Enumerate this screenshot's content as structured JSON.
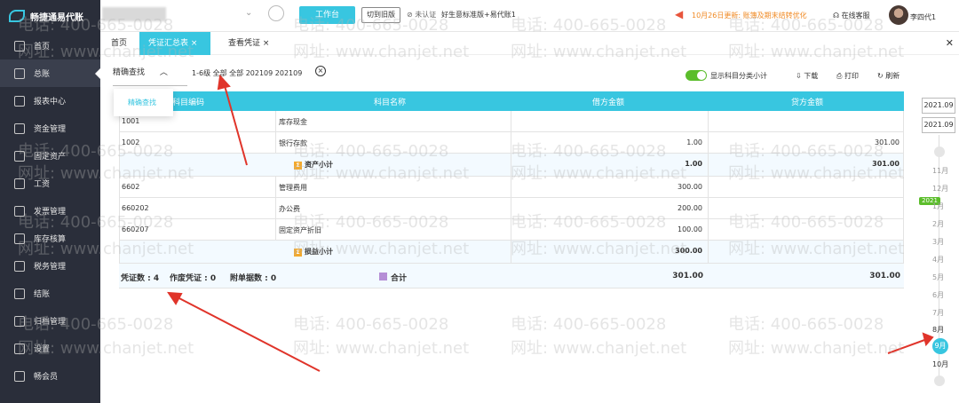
{
  "app": {
    "logo_text": "畅捷通易代账"
  },
  "header": {
    "workbench_label": "工作台",
    "switch_label": "切到旧版",
    "unverified_label": "未认证",
    "edition_label": "好生意标准版+易代账1",
    "notice_text": "10月26日更新: 账簿及期末结转优化",
    "service_label": "在线客服",
    "username": "李四代1"
  },
  "sidebar": {
    "items": [
      {
        "label": "首页",
        "icon": "home-icon"
      },
      {
        "label": "总账",
        "icon": "ledger-icon"
      },
      {
        "label": "报表中心",
        "icon": "chart-icon"
      },
      {
        "label": "资金管理",
        "icon": "money-icon"
      },
      {
        "label": "固定资产",
        "icon": "asset-icon"
      },
      {
        "label": "工资",
        "icon": "salary-icon"
      },
      {
        "label": "发票管理",
        "icon": "invoice-icon"
      },
      {
        "label": "库存核算",
        "icon": "stock-icon"
      },
      {
        "label": "税务管理",
        "icon": "tax-icon"
      },
      {
        "label": "结账",
        "icon": "close-book-icon"
      },
      {
        "label": "归档管理",
        "icon": "archive-icon"
      },
      {
        "label": "设置",
        "icon": "gear-icon"
      },
      {
        "label": "畅会员",
        "icon": "vip-icon"
      }
    ]
  },
  "tabs": [
    {
      "label": "首页"
    },
    {
      "label": "凭证汇总表"
    },
    {
      "label": "查看凭证"
    }
  ],
  "toolbar": {
    "search_label": "精确查找",
    "filter_text": "1-6级  全部 全部 202109 202109",
    "toggle_label": "显示科目分类小计",
    "download_label": "下载",
    "print_label": "打印",
    "refresh_label": "刷新"
  },
  "dropdown": {
    "item": "精确查找"
  },
  "table": {
    "headers": [
      "科目编码",
      "科目名称",
      "借方金额",
      "贷方金额"
    ],
    "rows": [
      {
        "code": "1001",
        "name": "库存现金",
        "debit": "",
        "credit": ""
      },
      {
        "code": "1002",
        "name": "银行存款",
        "debit": "1.00",
        "credit": "301.00"
      }
    ],
    "subtotal1": {
      "label": "资产小计",
      "debit": "1.00",
      "credit": "301.00"
    },
    "rows2": [
      {
        "code": "6602",
        "name": "管理费用",
        "debit": "300.00",
        "credit": ""
      },
      {
        "code": "660202",
        "name": "办公费",
        "debit": "200.00",
        "credit": ""
      },
      {
        "code": "660207",
        "name": "固定资产折旧",
        "debit": "100.00",
        "credit": ""
      }
    ],
    "subtotal2": {
      "label": "损益小计",
      "debit": "300.00",
      "credit": ""
    },
    "footer": {
      "voucher_count": "凭证数 : 4",
      "void_count": "作废凭证 : 0",
      "attach_count": "附单据数 : 0",
      "total_label": "合计",
      "total_debit": "301.00",
      "total_credit": "301.00"
    }
  },
  "date_panel": {
    "start": "2021.09",
    "end": "2021.09",
    "months": [
      "11月",
      "12月",
      "1月",
      "2月",
      "3月",
      "4月",
      "5月",
      "6月",
      "7月",
      "8月"
    ],
    "year_badge": "2021",
    "selected_month": "9月",
    "after_month": "10月"
  },
  "watermarks": {
    "phone": "电话: 400-665-0028",
    "site": "网址: www.chanjet.net"
  },
  "colors": {
    "accent": "#38c6e0",
    "sidebar": "#2a2e3a",
    "toggle": "#5bbd2b",
    "notice": "#f08a24"
  }
}
